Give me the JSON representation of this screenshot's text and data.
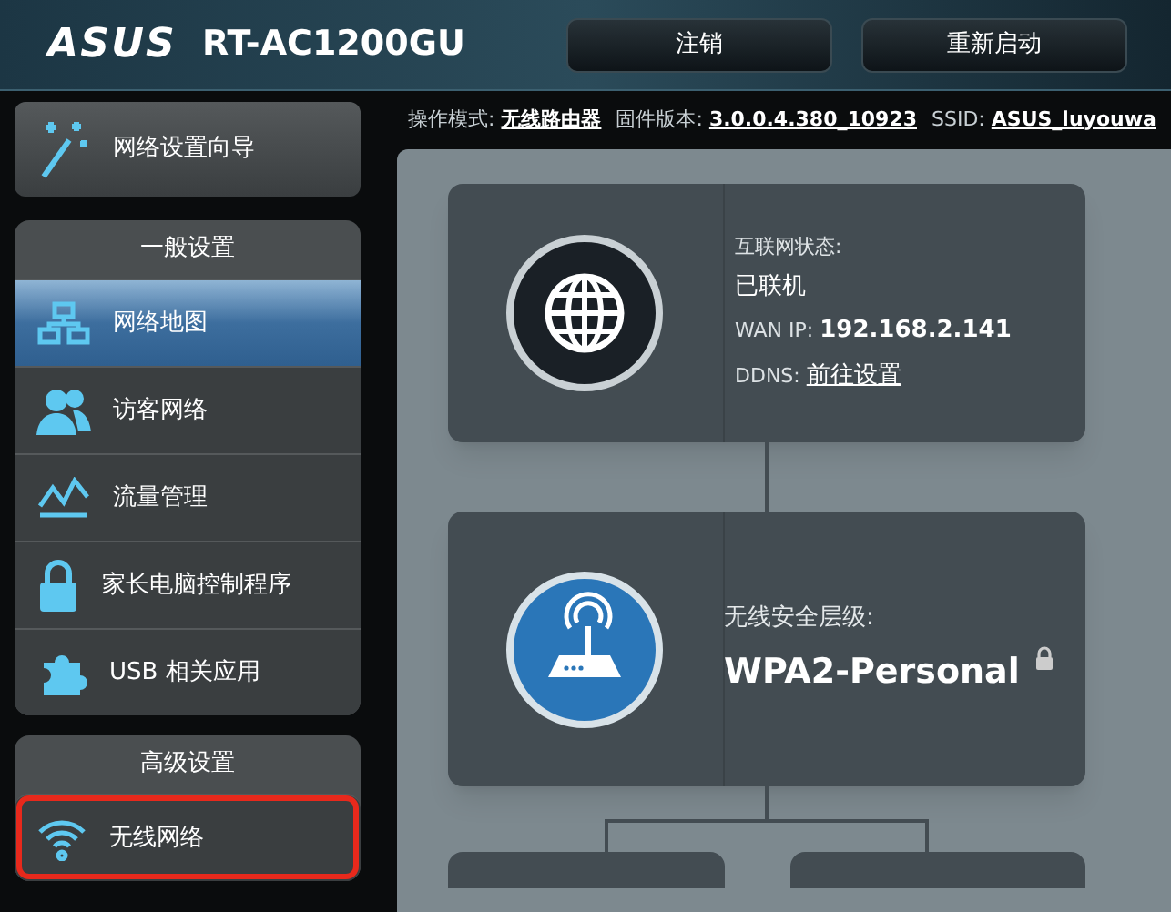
{
  "header": {
    "brand": "ASUS",
    "model": "RT-AC1200GU",
    "buttons": [
      "注销",
      "重新启动"
    ]
  },
  "wizard": {
    "label": "网络设置向导"
  },
  "info_bar": [
    {
      "label": "操作模式:",
      "value": "无线路由器"
    },
    {
      "label": "固件版本:",
      "value": "3.0.0.4.380_10923"
    },
    {
      "label": "SSID:",
      "value": "ASUS_luyouwa"
    }
  ],
  "sidebar": [
    {
      "title": "一般设置",
      "items": [
        {
          "label": "网络地图",
          "kind": "map",
          "selected": true,
          "highlighted": false
        },
        {
          "label": "访客网络",
          "kind": "guest",
          "selected": false,
          "highlighted": false
        },
        {
          "label": "流量管理",
          "kind": "traffic",
          "selected": false,
          "highlighted": false
        },
        {
          "label": "家长电脑控制程序",
          "kind": "lock",
          "selected": false,
          "highlighted": false
        },
        {
          "label": "USB 相关应用",
          "kind": "usb",
          "selected": false,
          "highlighted": false
        }
      ]
    },
    {
      "title": "高级设置",
      "items": [
        {
          "label": "无线网络",
          "kind": "wifi",
          "selected": false,
          "highlighted": true
        }
      ]
    }
  ],
  "internet_card": {
    "status_label": "互联网状态:",
    "status": "已联机",
    "wan_label": "WAN IP:",
    "wan_ip": "192.168.2.141",
    "ddns_label": "DDNS:",
    "ddns_link": "前往设置"
  },
  "wireless_card": {
    "label": "无线安全层级:",
    "value": "WPA2-Personal"
  }
}
